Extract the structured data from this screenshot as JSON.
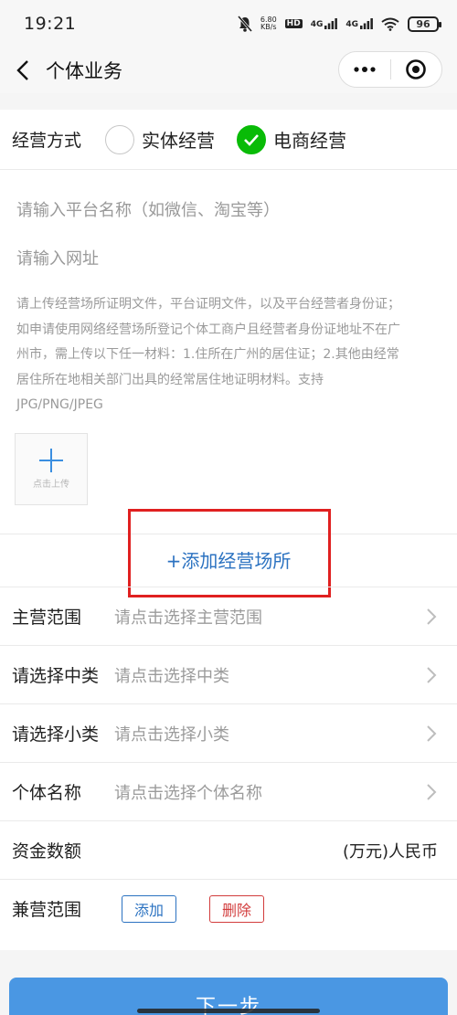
{
  "status_bar": {
    "time": "19:21",
    "net_speed": "6.80",
    "net_unit": "KB/s",
    "hd_tag": "HD",
    "signal_1": "4G",
    "signal_2": "4G",
    "battery": "96"
  },
  "navbar": {
    "title": "个体业务",
    "icons": [
      "back-icon",
      "more-icon",
      "close-target-icon"
    ]
  },
  "form": {
    "mode": {
      "label": "经营方式",
      "options": [
        {
          "label": "实体经营",
          "selected": false
        },
        {
          "label": "电商经营",
          "selected": true
        }
      ]
    },
    "platform_name_placeholder": "请输入平台名称（如微信、淘宝等）",
    "url_placeholder": "请输入网址",
    "upload_hint_lines": [
      "请上传经营场所证明文件，平台证明文件，以及平台经营者身份证；",
      "如申请使用网络经营场所登记个体工商户且经营者身份证地址不在广",
      "州市，需上传以下任一材料：1.住所在广州的居住证；2.其他由经常",
      "居住所在地相关部门出具的经常居住地证明材料。支持",
      "JPG/PNG/JPEG"
    ],
    "upload_label": "点击上传",
    "add_place": "+添加经营场所",
    "rows": [
      {
        "label": "主营范围",
        "value": "请点击选择主营范围"
      },
      {
        "label": "请选择中类",
        "value": "请点击选择中类"
      },
      {
        "label": "请选择小类",
        "value": "请点击选择小类"
      },
      {
        "label": "个体名称",
        "value": "请点击选择个体名称"
      }
    ],
    "capital": {
      "label": "资金数额",
      "unit": "(万元)人民币"
    },
    "side_scope": {
      "label": "兼营范围",
      "add": "添加",
      "delete": "删除"
    }
  },
  "next_button": "下一步",
  "colors": {
    "accent_green": "#09bb07",
    "link_blue": "#2b72c1",
    "button_blue": "#4a97e3",
    "delete_red": "#d23c3c",
    "highlight_red": "#e02020"
  }
}
